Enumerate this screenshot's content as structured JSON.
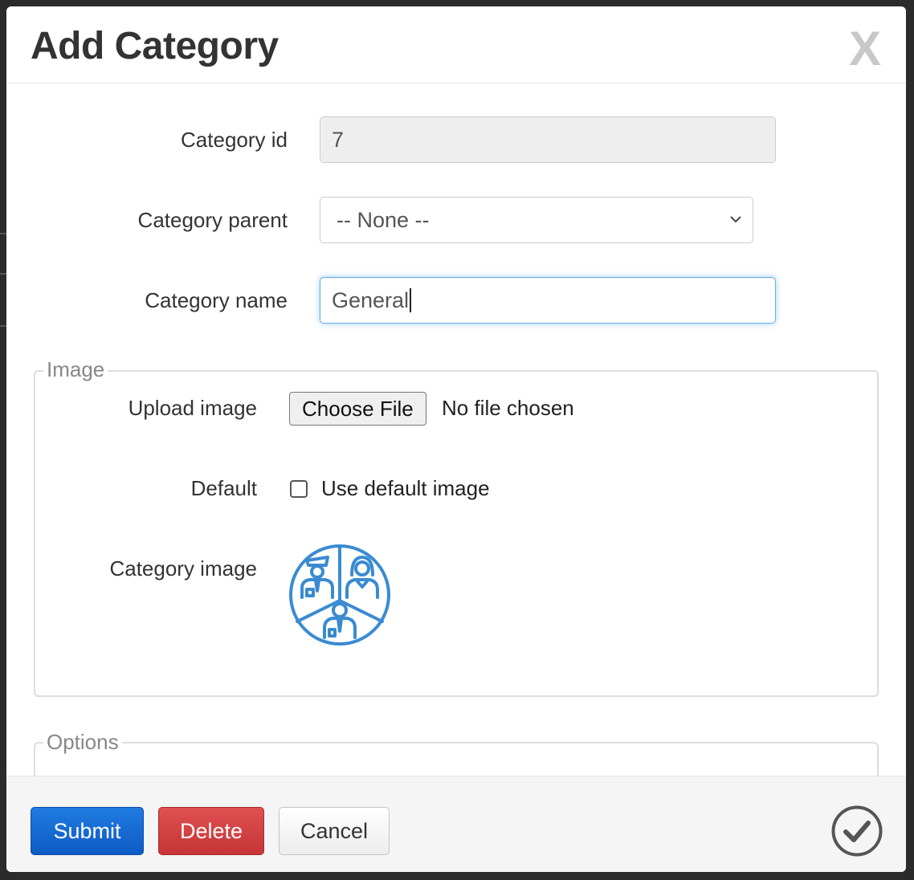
{
  "dialog": {
    "title": "Add Category",
    "close_symbol": "X"
  },
  "form": {
    "category_id": {
      "label": "Category id",
      "value": "7"
    },
    "category_parent": {
      "label": "Category parent",
      "selected": "-- None --"
    },
    "category_name": {
      "label": "Category name",
      "value": "General"
    }
  },
  "image_group": {
    "legend": "Image",
    "upload": {
      "label": "Upload image",
      "button": "Choose File",
      "status": "No file chosen"
    },
    "default": {
      "label": "Default",
      "checkbox_label": "Use default image",
      "checked": false
    },
    "category_image": {
      "label": "Category image",
      "icon": "team-group-icon",
      "color": "#3a8bd1"
    }
  },
  "options_group": {
    "legend": "Options"
  },
  "footer": {
    "submit": "Submit",
    "delete": "Delete",
    "cancel": "Cancel",
    "confirm_icon": "check-circle-icon"
  },
  "colors": {
    "primary": "#1f7be0",
    "danger": "#d9534f",
    "focus": "#66afe9"
  }
}
